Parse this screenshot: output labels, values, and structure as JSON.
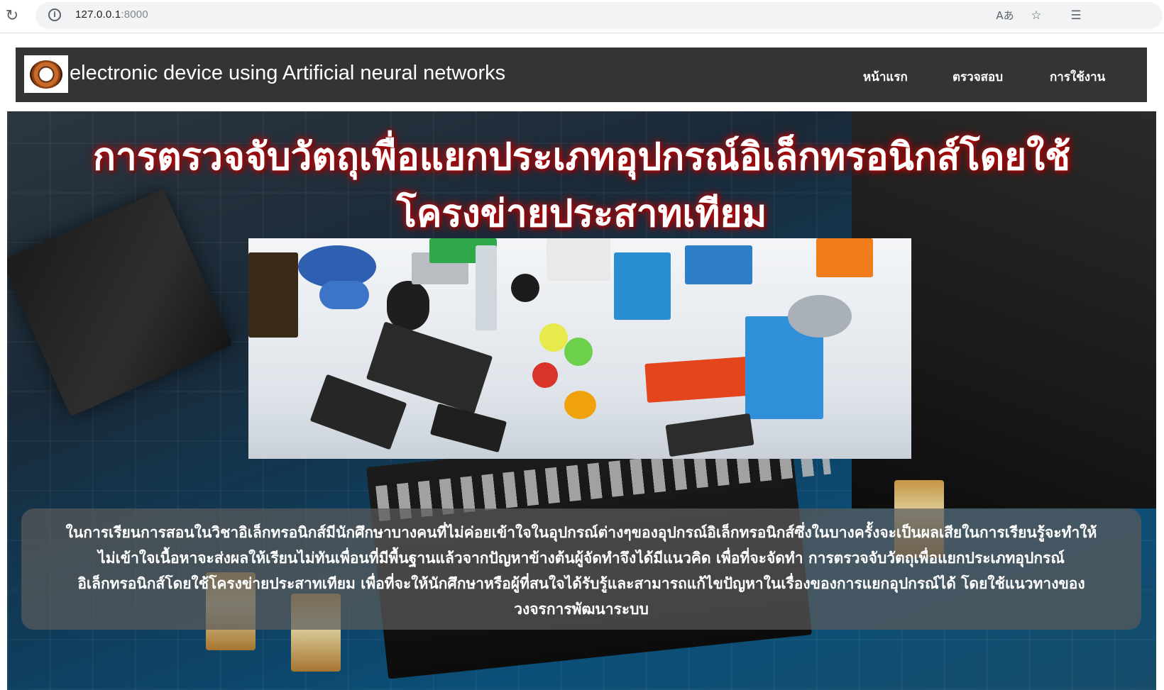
{
  "browser": {
    "url_host": "127.0.0.1",
    "url_port": ":8000",
    "read_aloud_label": "Aあ"
  },
  "site": {
    "brand_text": "electronic device using Artificial neural networks",
    "nav": [
      {
        "label": "หน้าแรก"
      },
      {
        "label": "ตรวจสอบ"
      },
      {
        "label": "การใช้งาน"
      }
    ]
  },
  "hero": {
    "title_line1": "การตรวจจับวัตถุเพื่อแยกประเภทอุปกรณ์อิเล็กทรอนิกส์โดยใช้",
    "title_line2": "โครงข่ายประสาทเทียม",
    "title_glow_color": "#c01010",
    "description": "ในการเรียนการสอนในวิชาอิเล็กทรอนิกส์มีนักศึกษาบางคนที่ไม่ค่อยเข้าใจในอุปกรณ์ต่างๆของอุปกรณ์อิเล็กทรอนิกส์ซึ่งในบางครั้งจะเป็นผลเสียในการเรียนรู้จะทำให้ไม่เข้าใจเนื้อหาจะส่งผลให้เรียนไม่ทันเพื่อนที่มีพื้นฐานแล้วจากปัญหาข้างต้นผู้จัดทำจึงได้มีแนวคิด เพื่อที่จะจัดทำ การตรวจจับวัตถุเพื่อแยกประเภทอุปกรณ์อิเล็กทรอนิกส์โดยใช้โครงข่ายประสาทเทียม เพื่อที่จะให้นักศึกษาหรือผู้ที่สนใจได้รับรู้และสามารถแก้ไขปัญหาในเรื่องของการแยกอุปกรณ์ได้ โดยใช้แนวทางของ วงจรการพัฒนาระบบ"
  },
  "icons": {
    "reload": "reload-icon",
    "info": "info-icon",
    "favorite_add": "favorite-add-icon",
    "favorites": "favorites-icon"
  }
}
